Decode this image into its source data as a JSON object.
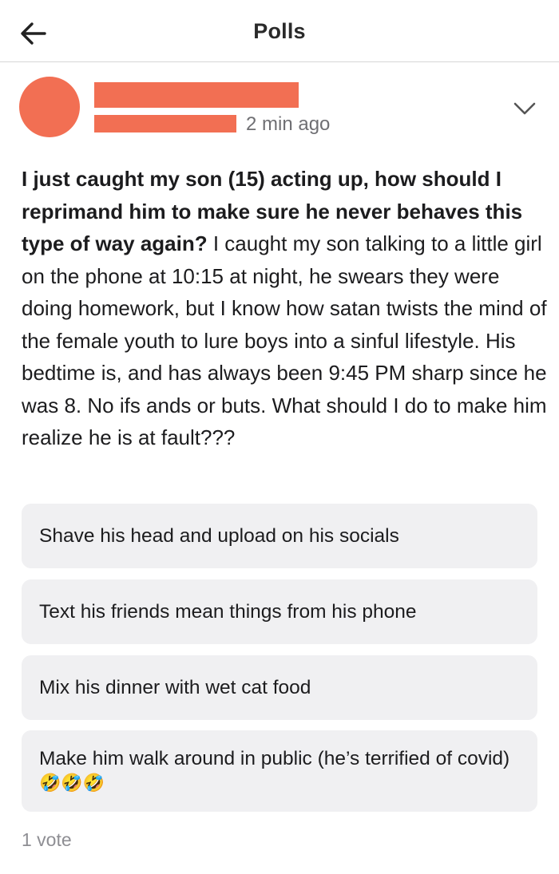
{
  "header": {
    "title": "Polls"
  },
  "post": {
    "timestamp": "2 min ago",
    "title": "I just caught my son (15) acting up, how should I reprimand him to make sure he never behaves this type of way again?",
    "body": " I caught my son talking to a little girl on the phone at 10:15 at night, he swears they were doing homework, but I know how satan twists the mind of the female youth to lure boys into a sinful lifestyle. His bedtime is, and has always been 9:45 PM sharp since he was 8. No ifs ands or buts. What should I do to make him realize he is at fault???"
  },
  "options": [
    {
      "label": "Shave his head and upload on his socials"
    },
    {
      "label": "Text his friends mean things from his phone"
    },
    {
      "label": "Mix his dinner with wet cat food"
    },
    {
      "label": "Make him walk around in public (he’s terrified of covid)",
      "emoji": "🤣🤣🤣"
    }
  ],
  "votes": {
    "label": "1 vote"
  },
  "colors": {
    "redaction": "#f26f53",
    "option_bg": "#f0f0f2"
  },
  "icons": {
    "back": "back-arrow-icon",
    "more": "chevron-down-icon"
  }
}
